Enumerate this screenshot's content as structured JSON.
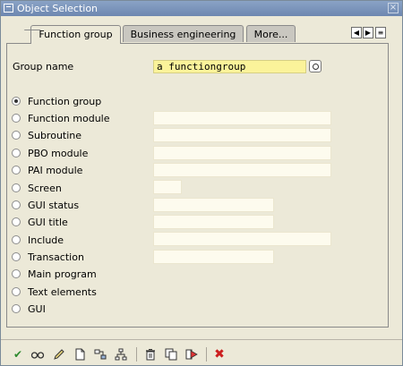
{
  "window": {
    "title": "Object Selection"
  },
  "tabs": [
    {
      "label": "Function group"
    },
    {
      "label": "Business engineering"
    },
    {
      "label": "More..."
    }
  ],
  "group": {
    "label": "Group name",
    "value": "a functiongroup"
  },
  "options": [
    {
      "label": "Function group",
      "selected": true
    },
    {
      "label": "Function module"
    },
    {
      "label": "Subroutine"
    },
    {
      "label": "PBO module"
    },
    {
      "label": "PAI module"
    },
    {
      "label": "Screen"
    },
    {
      "label": "GUI status"
    },
    {
      "label": "GUI title"
    },
    {
      "label": "Include"
    },
    {
      "label": "Transaction"
    },
    {
      "label": "Main program"
    },
    {
      "label": "Text elements"
    },
    {
      "label": "GUI"
    }
  ],
  "toolbar": {
    "icons": [
      "checkmark-icon",
      "glasses-icon",
      "pencil-icon",
      "new-document-icon",
      "where-used-icon",
      "hierarchy-icon",
      "delete-icon",
      "copy-icon",
      "execute-icon",
      "cancel-icon"
    ]
  },
  "colors": {
    "title_bar": "#6d87b0",
    "dialog_bg": "#ece9d8",
    "required_field": "#fbf39a",
    "input_field": "#fdfbee",
    "cancel_red": "#cc1f1f",
    "confirm_green": "#2e8a2e"
  }
}
